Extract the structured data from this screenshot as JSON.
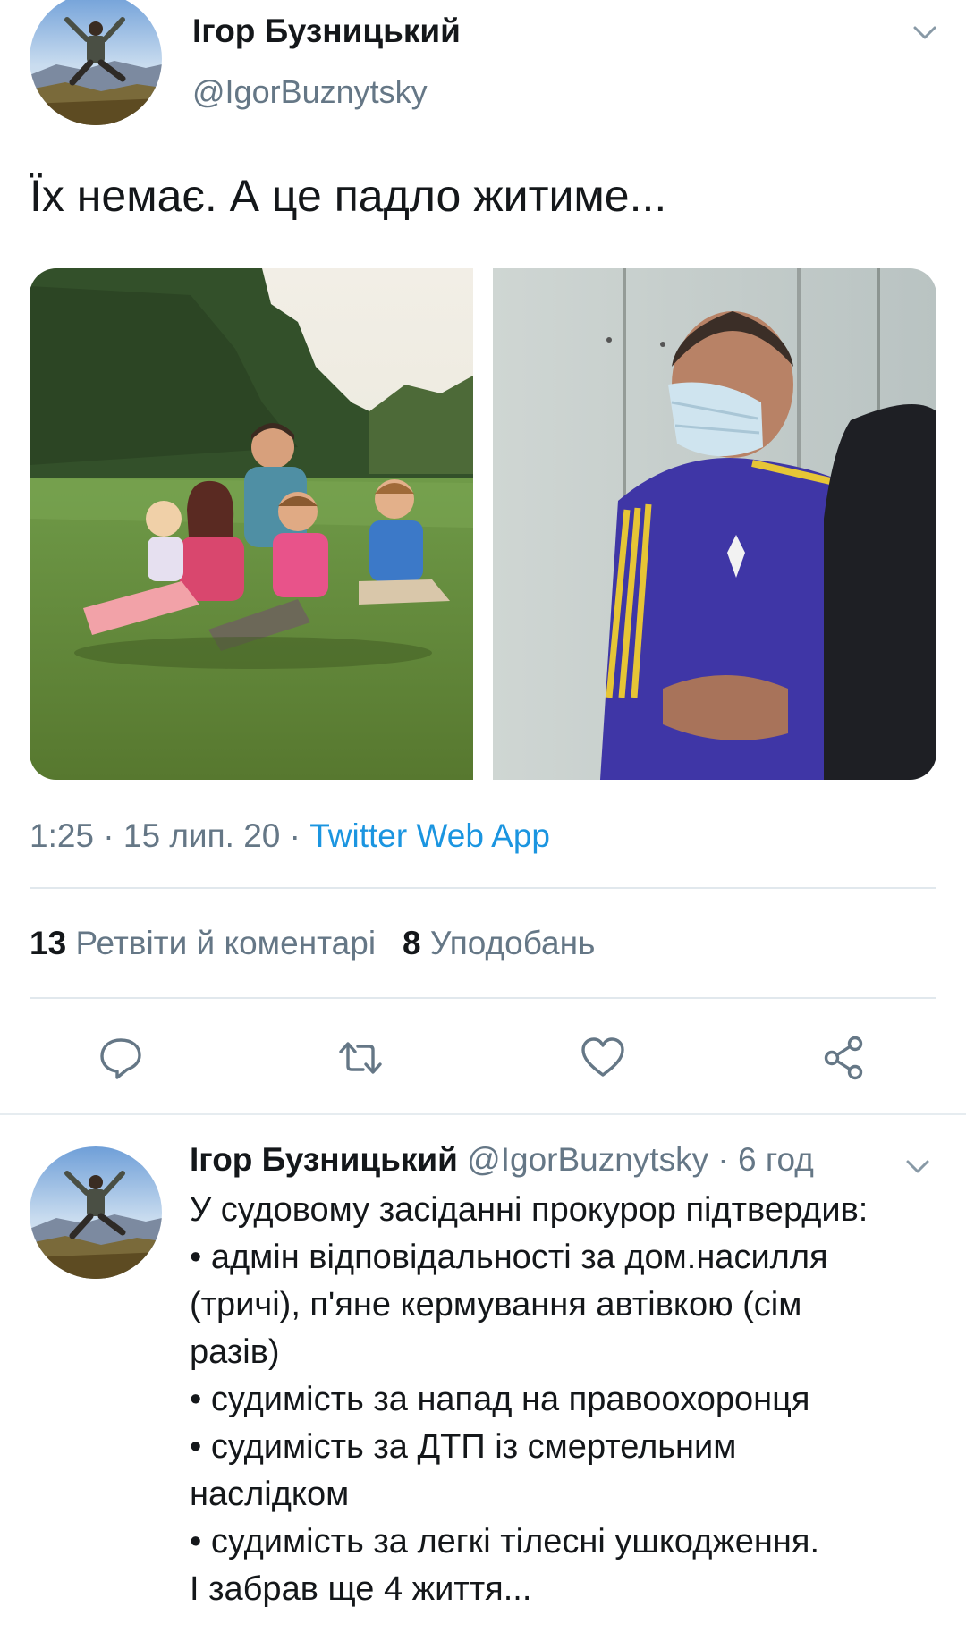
{
  "tweet": {
    "author_name": "Ігор Бузницький",
    "author_handle": "@IgorBuznytsky",
    "text": "Їх немає. А це падло житиме...",
    "time": "1:25",
    "date": "15 лип. 20",
    "source": "Twitter Web App",
    "retweets_count": "13",
    "retweets_label": "Ретвіти й коментарі",
    "likes_count": "8",
    "likes_label": "Уподобань",
    "icons": [
      "reply-icon",
      "retweet-icon",
      "like-icon",
      "share-icon",
      "chevron-down-icon"
    ]
  },
  "reply": {
    "author_name": "Ігор Бузницький",
    "author_handle": "@IgorBuznytsky",
    "time_ago": "6 год",
    "lines": [
      "У судовому засіданні прокурор підтвердив:",
      "• адмін відповідальності за дом.насилля",
      "(тричі), п'яне кермування автівкою (сім",
      "разів)",
      "• судимість за напад на правоохоронця",
      "• судимість за ДТП із смертельним",
      "наслідком",
      "• судимість за легкі тілесні ушкодження.",
      "І забрав ще 4 життя..."
    ]
  },
  "colors": {
    "text": "#14171a",
    "secondary": "#657786",
    "link": "#1b95e0",
    "divider": "#e1e8ed"
  }
}
